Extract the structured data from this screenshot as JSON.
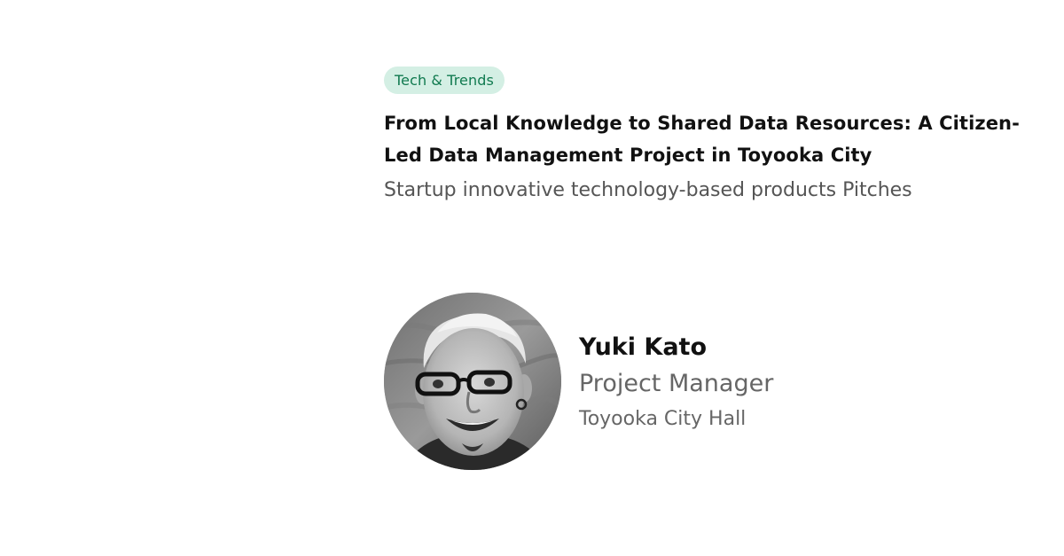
{
  "session": {
    "tag": "Tech & Trends",
    "title": "From Local Knowledge to Shared Data Resources: A Citizen-Led Data Management Project in Toyooka City",
    "subtitle": "Startup innovative technology-based products Pitches"
  },
  "speaker": {
    "name": "Yuki Kato",
    "role": "Project Manager",
    "organization": "Toyooka City Hall",
    "photo_icon": "speaker-portrait"
  },
  "colors": {
    "tag_background": "#d4efe4",
    "tag_text": "#107a4f",
    "title": "#111111",
    "muted": "#555555"
  }
}
